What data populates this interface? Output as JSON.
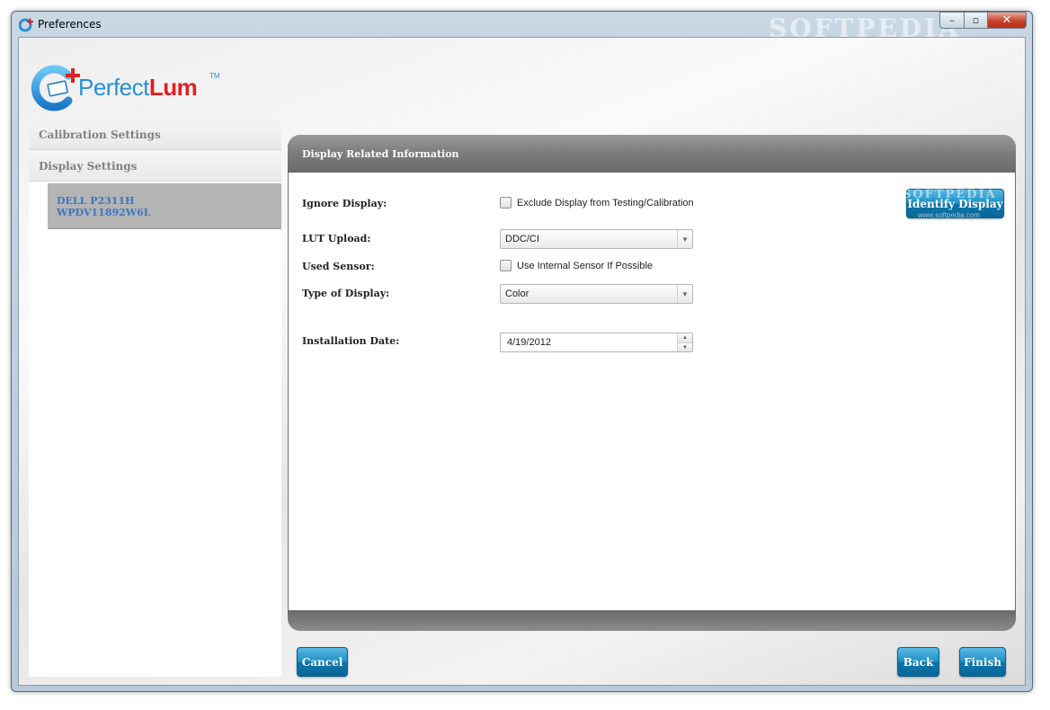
{
  "window": {
    "title": "Preferences",
    "watermark": "SOFTPEDIA",
    "minimize": "–",
    "maximize": "▫",
    "close": "✕"
  },
  "logo": {
    "text_light": "Perfect",
    "text_bold": "Lum",
    "trademark": "TM"
  },
  "sidebar": {
    "items": [
      {
        "label": "Calibration Settings"
      },
      {
        "label": "Display Settings"
      }
    ],
    "display_entry": {
      "line1": "DELL P2311H",
      "line2": "WPDV11892W6L"
    }
  },
  "panel": {
    "title": "Display Related Information",
    "fields": {
      "ignore_display": {
        "label": "Ignore Display:",
        "checkbox_label": "Exclude Display from Testing/Calibration"
      },
      "lut_upload": {
        "label": "LUT Upload:",
        "value": "DDC/CI"
      },
      "used_sensor": {
        "label": "Used Sensor:",
        "checkbox_label": "Use Internal Sensor If Possible"
      },
      "type_of_display": {
        "label": "Type of Display:",
        "value": "Color"
      },
      "installation_date": {
        "label": "Installation Date:",
        "value": "4/19/2012"
      }
    },
    "identify_button": "Identify Display",
    "identify_watermark": "SOFTPEDIA",
    "identify_watermark_url": "www.softpedia.com"
  },
  "footer": {
    "cancel": "Cancel",
    "back": "Back",
    "finish": "Finish"
  },
  "colors": {
    "accent": "#1d90c6",
    "brand_blue": "#2a8fd6",
    "brand_red": "#e02020",
    "sidebar_link": "#3a78c4"
  }
}
